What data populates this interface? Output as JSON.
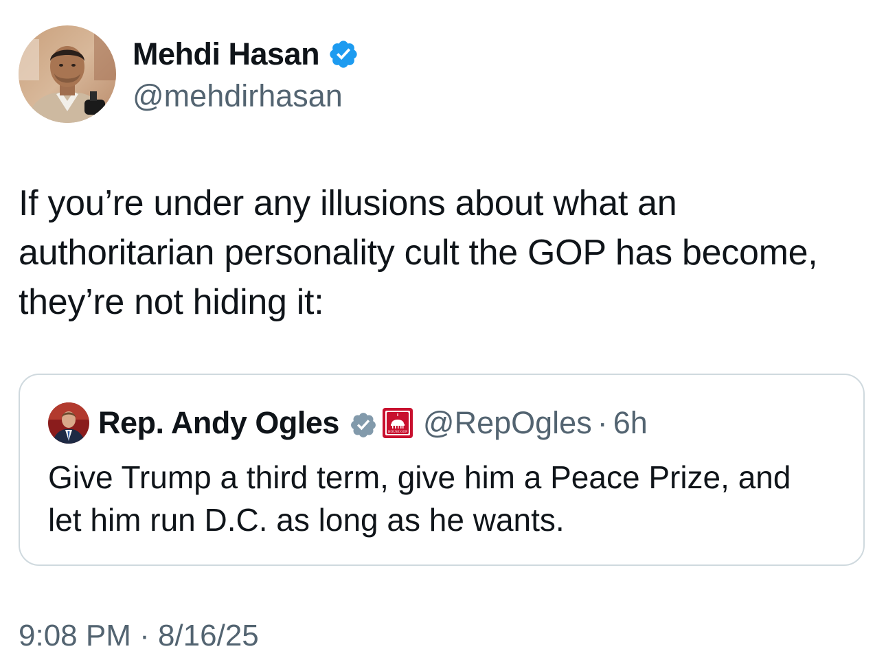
{
  "author": {
    "display_name": "Mehdi Hasan",
    "handle": "@mehdirhasan",
    "verified_icon": "verified-badge-blue",
    "avatar_icon": "profile-photo"
  },
  "tweet": {
    "text_lines": [
      "If you’re under any illusions about what an",
      "authoritarian personality cult the GOP has become,",
      "they’re not hiding it:"
    ]
  },
  "quoted_tweet": {
    "display_name": "Rep. Andy Ogles",
    "verified_icon": "verified-badge-gray",
    "affiliation_badge_icon": "house-gop-badge",
    "affiliation_badge_text": "HOUSE GOP",
    "handle": "@RepOgles",
    "separator": "·",
    "time_ago": "6h",
    "text_lines": [
      "Give Trump a third term, give him a Peace Prize, and",
      "let him run D.C. as long as he wants."
    ]
  },
  "timestamp": "9:08 PM · 8/16/25",
  "colors": {
    "primary_text": "#0f1419",
    "secondary_text": "#536471",
    "border": "#cfd9de",
    "verified_blue": "#1d9bf0",
    "verified_gray": "#829aab",
    "gop_red": "#c8102e"
  }
}
